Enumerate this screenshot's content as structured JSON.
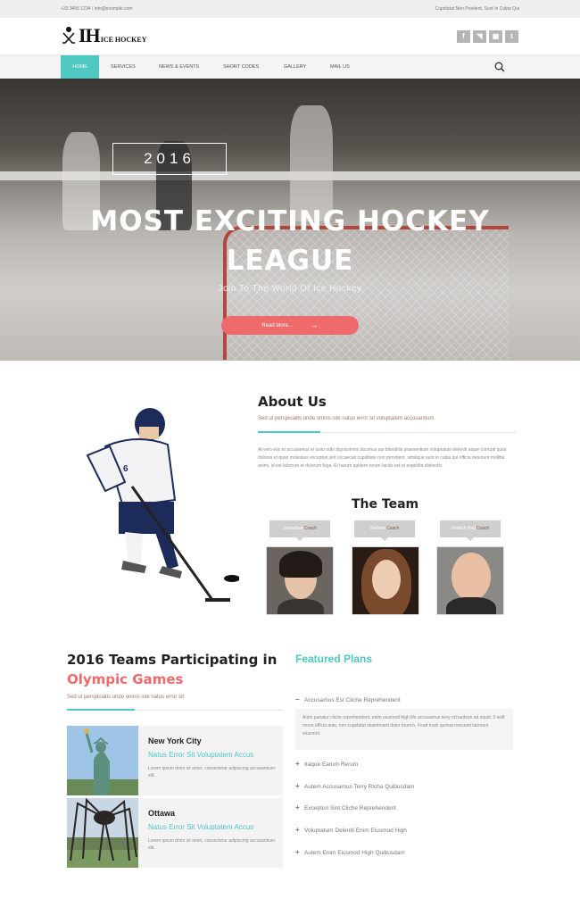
{
  "topbar": {
    "contact": "+33 3456 1234 / info@example.com",
    "tagline": "Cupidatat Non Proident, Sunt In Culpa Qui"
  },
  "header": {
    "logo_big": "IH",
    "logo_small": "ICE HOCKEY",
    "social": [
      "f",
      "rss",
      "ig",
      "t"
    ]
  },
  "nav": {
    "items": [
      "HOME",
      "SERVICES",
      "NEWS & EVENTS",
      "SHORT CODES",
      "GALLERY",
      "MAIL US"
    ],
    "active": "HOME",
    "search_icon": "search-icon"
  },
  "hero": {
    "year": "2016",
    "title_line1": "MOST EXCITING HOCKEY",
    "title_line2": "LEAGUE",
    "subtitle": "Join To The World Of Ice Hockey",
    "button": "Read More...",
    "button_icon": "arrow-right-icon"
  },
  "about": {
    "title": "About Us",
    "subtitle": "Sed ut perspiciatis unde omnis iste natus error sit voluptatem accusantium",
    "text": "At vero eos et accusamus et iusto odio dignissimos ducimus qui blanditiis praesentium voluptatum deleniti atque corrupti quos dolores et quas molestias excepturi sint occaecati cupiditate non provident, similique sunt in culpa qui officia deserunt mollitia animi, id est laborum et dolorum fuga. Et harum quidem rerum facilis est et expedita distinctio."
  },
  "team": {
    "title": "The Team",
    "members": [
      {
        "name": "Johnathan",
        "role": "Coach"
      },
      {
        "name": "Stefanie",
        "role": "Coach"
      },
      {
        "name": "Fedrick Paul",
        "role": "Coach"
      }
    ]
  },
  "teams": {
    "title_line1": "2016 Teams Participating in",
    "title_line2": "Olympic Games",
    "subtitle": "Sed ut perspiciatis unde omnis iste natus error sit",
    "cards": [
      {
        "name": "New York City",
        "tagline": "Natus Error Sit Voluptatem Accus",
        "desc": "Lorem ipsum dolor sit amet, consectetur adipiscing accusantium elit."
      },
      {
        "name": "Ottawa",
        "tagline": "Natus Error Sit Voluptatem Accus",
        "desc": "Lorem ipsum dolor sit amet, consectetur adipiscing accusantium elit."
      }
    ]
  },
  "plans": {
    "title": "Featured Plans",
    "open_item": "Accusamus Est Cliche Reprehenderit",
    "open_body": "Anim pariatur cliche reprehenderit, enim eiusmod high life accusamus terry richardson ad squid. 3 wolf moon officia aute, non cupidatat skateboard dolor brunch. Food truck quinoa nesciunt laborum eiusmod.",
    "items": [
      "Itaque Earum Rerum",
      "Autem Accusamus Terry Richa Quibusdam",
      "Excepturi Sint Cliche Reprehenderit",
      "Voluptatum Deleniti Enim Eiusmod High",
      "Autem Enim Eiusmod High Quibusdam"
    ]
  }
}
